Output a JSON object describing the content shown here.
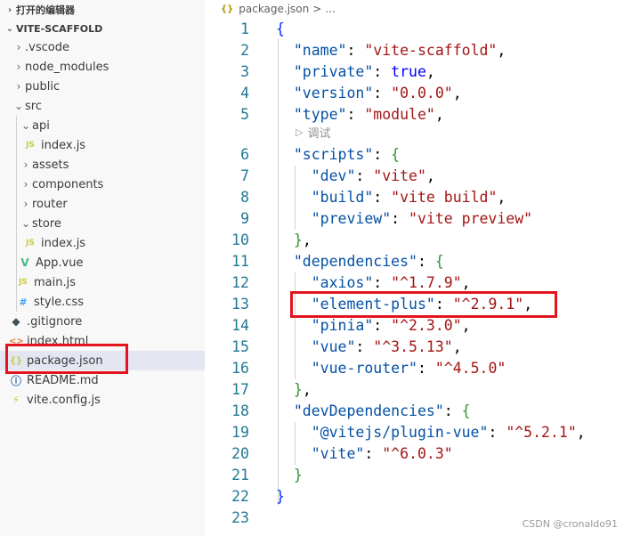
{
  "explorer": {
    "open_editors_title": "打开的编辑器",
    "project_title": "VITE-SCAFFOLD",
    "items": [
      {
        "label": "vscode_dir",
        "text": ".vscode"
      },
      {
        "label": "node_modules",
        "text": "node_modules"
      },
      {
        "label": "public",
        "text": "public"
      },
      {
        "label": "src",
        "text": "src"
      },
      {
        "label": "api",
        "text": "api"
      },
      {
        "label": "api_index",
        "text": "index.js"
      },
      {
        "label": "assets",
        "text": "assets"
      },
      {
        "label": "components",
        "text": "components"
      },
      {
        "label": "router",
        "text": "router"
      },
      {
        "label": "store",
        "text": "store"
      },
      {
        "label": "store_index",
        "text": "index.js"
      },
      {
        "label": "app_vue",
        "text": "App.vue"
      },
      {
        "label": "main_js",
        "text": "main.js"
      },
      {
        "label": "style_css",
        "text": "style.css"
      },
      {
        "label": "gitignore",
        "text": ".gitignore"
      },
      {
        "label": "index_html",
        "text": "index.html"
      },
      {
        "label": "package_json",
        "text": "package.json"
      },
      {
        "label": "readme",
        "text": "README.md"
      },
      {
        "label": "vite_config",
        "text": "vite.config.js"
      }
    ],
    "icons": {
      "js": "JS",
      "vue": "V",
      "css": "#",
      "git": "◆",
      "html": "<>",
      "json": "{}",
      "info": "ⓘ",
      "vite": "⚡"
    }
  },
  "breadcrumb": {
    "icon": "{}",
    "file": "package.json",
    "sep": ">",
    "more": "..."
  },
  "codelens": {
    "label": "调试"
  },
  "code": {
    "line_numbers": [
      "1",
      "2",
      "3",
      "4",
      "5",
      "6",
      "7",
      "8",
      "9",
      "10",
      "11",
      "12",
      "13",
      "14",
      "15",
      "16",
      "17",
      "18",
      "19",
      "20",
      "21",
      "22",
      "23"
    ],
    "name_key": "\"name\"",
    "name_val": "\"vite-scaffold\"",
    "private_key": "\"private\"",
    "private_val": "true",
    "version_key": "\"version\"",
    "version_val": "\"0.0.0\"",
    "type_key": "\"type\"",
    "type_val": "\"module\"",
    "scripts_key": "\"scripts\"",
    "dev_key": "\"dev\"",
    "dev_val": "\"vite\"",
    "build_key": "\"build\"",
    "build_val": "\"vite build\"",
    "preview_key": "\"preview\"",
    "preview_val": "\"vite preview\"",
    "deps_key": "\"dependencies\"",
    "axios_key": "\"axios\"",
    "axios_val": "\"^1.7.9\"",
    "ep_key": "\"element-plus\"",
    "ep_val": "\"^2.9.1\"",
    "pinia_key": "\"pinia\"",
    "pinia_val": "\"^2.3.0\"",
    "vue_key": "\"vue\"",
    "vue_val": "\"^3.5.13\"",
    "vr_key": "\"vue-router\"",
    "vr_val": "\"^4.5.0\"",
    "devdeps_key": "\"devDependencies\"",
    "pv_key": "\"@vitejs/plugin-vue\"",
    "pv_val": "\"^5.2.1\"",
    "vite_key": "\"vite\"",
    "vite_val": "\"^6.0.3\""
  },
  "watermark": "CSDN @cronaldo91",
  "colors": {
    "highlight": "#e3141d",
    "json_key": "#0451a5",
    "json_string": "#a31515",
    "line_number": "#237893"
  }
}
